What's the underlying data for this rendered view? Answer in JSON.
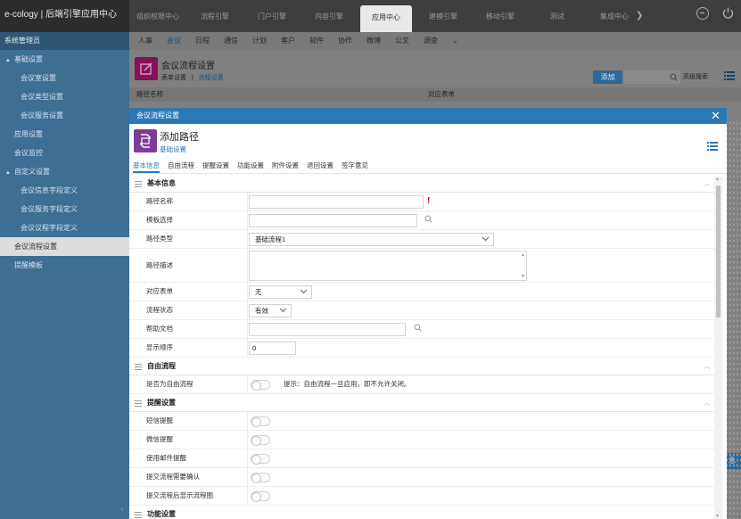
{
  "app": {
    "title": "e-cology | 后端引擎应用中心"
  },
  "topnav": [
    {
      "label": "组织权限中心",
      "active": false
    },
    {
      "label": "流程引擎",
      "active": false
    },
    {
      "label": "门户引擎",
      "active": false
    },
    {
      "label": "内容引擎",
      "active": false
    },
    {
      "label": "应用中心",
      "active": true
    },
    {
      "label": "建模引擎",
      "active": false
    },
    {
      "label": "移动引擎",
      "active": false
    },
    {
      "label": "测试",
      "active": false
    },
    {
      "label": "集成中心",
      "active": false
    }
  ],
  "topnav_more": "❯",
  "sidebar": {
    "header": "系统管理员",
    "items": [
      {
        "label": "基础设置",
        "kind": "group"
      },
      {
        "label": "会议室设置",
        "kind": "lvl1"
      },
      {
        "label": "会议类型设置",
        "kind": "lvl1"
      },
      {
        "label": "会议服务设置",
        "kind": "lvl1"
      },
      {
        "label": "应用设置",
        "kind": "lvl0"
      },
      {
        "label": "会议监控",
        "kind": "lvl0"
      },
      {
        "label": "自定义设置",
        "kind": "group"
      },
      {
        "label": "会议信息字段定义",
        "kind": "lvl1"
      },
      {
        "label": "会议服务字段定义",
        "kind": "lvl1"
      },
      {
        "label": "会议议程字段定义",
        "kind": "lvl1"
      },
      {
        "label": "会议流程设置",
        "kind": "lvl0",
        "active": true
      },
      {
        "label": "提醒模板",
        "kind": "lvl0"
      }
    ]
  },
  "subnav": [
    {
      "label": "人事"
    },
    {
      "label": "会议",
      "active": true
    },
    {
      "label": "日程"
    },
    {
      "label": "通信"
    },
    {
      "label": "计划"
    },
    {
      "label": "客户"
    },
    {
      "label": "邮件"
    },
    {
      "label": "协作"
    },
    {
      "label": "微博"
    },
    {
      "label": "公文"
    },
    {
      "label": "调查"
    },
    {
      "label": "⌄"
    }
  ],
  "module": {
    "title": "会议流程设置",
    "crumb_parent": "表单设置",
    "crumb_sep": "|",
    "crumb_current": "流程设置",
    "add_label": "添加",
    "adv_search": "高级搜索",
    "col_path_name": "路径名称",
    "col_form": "对应表单",
    "partial_button": "急"
  },
  "dialog": {
    "titlebar": "会议流程设置",
    "close": "✕",
    "title": "添加路径",
    "subtitle": "基础设置",
    "tabs": [
      {
        "label": "基本信息",
        "active": true
      },
      {
        "label": "自由流程"
      },
      {
        "label": "提醒设置"
      },
      {
        "label": "功能设置"
      },
      {
        "label": "附件设置"
      },
      {
        "label": "退回设置"
      },
      {
        "label": "签字意见"
      }
    ],
    "basic": {
      "heading": "基本信息",
      "path_name_label": "路径名称",
      "path_name_value": "",
      "required_mark": "!",
      "template_label": "模板选择",
      "template_value": "",
      "path_type_label": "路径类型",
      "path_type_value": "基础流程1",
      "path_desc_label": "路径描述",
      "form_label": "对应表单",
      "form_value": "无",
      "status_label": "流程状态",
      "status_value": "有效",
      "help_label": "帮助文档",
      "help_value": "",
      "order_label": "显示顺序",
      "order_value": "0"
    },
    "free": {
      "heading": "自由流程",
      "is_free_label": "是否为自由流程",
      "is_free_on": false,
      "hint": "提示：自由流程一旦启用，即不允许关闭。"
    },
    "remind": {
      "heading": "提醒设置",
      "items": [
        {
          "label": "短信提醒",
          "on": false
        },
        {
          "label": "微信提醒",
          "on": false
        },
        {
          "label": "使用邮件提醒",
          "on": false
        },
        {
          "label": "提交流程需要确认",
          "on": false
        },
        {
          "label": "提交流程后显示流程图",
          "on": false
        }
      ]
    },
    "function": {
      "heading": "功能设置"
    }
  },
  "colors": {
    "topbar": "#3e3e3e",
    "sidebar": "#3d6f95",
    "dialog_titlebar": "#2b78b8",
    "accent": "#2b78b8",
    "module_icon": "#86125a",
    "dialog_icon": "#7e3c97",
    "required": "#d0021b"
  },
  "icons": {
    "module": "edit-icon",
    "dialog": "path-swap-icon",
    "menu": "list-menu-icon",
    "search": "magnifier-icon",
    "top_right": [
      "user-circle-icon",
      "power-icon"
    ]
  }
}
